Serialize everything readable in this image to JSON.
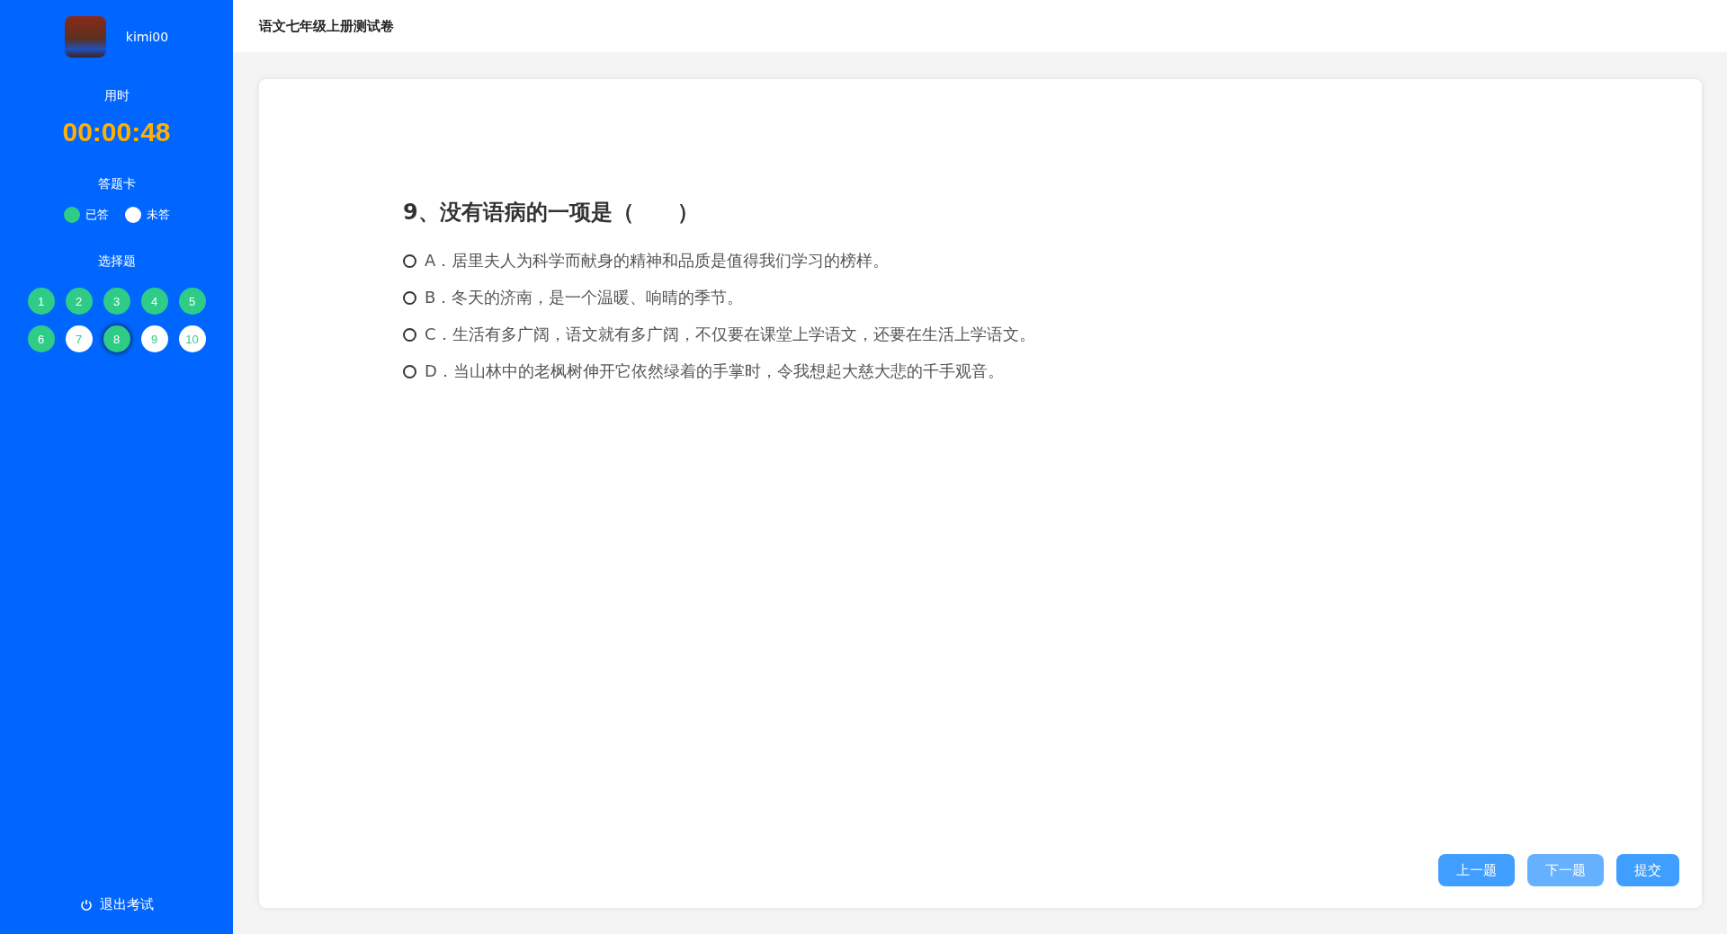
{
  "user": {
    "name": "kimi00"
  },
  "timer": {
    "label": "用时",
    "value": "00:00:48"
  },
  "answer_card": {
    "title": "答题卡",
    "legend": [
      {
        "label": "已答",
        "answered": true
      },
      {
        "label": "未答",
        "answered": false
      }
    ],
    "section": "选择题",
    "items": [
      {
        "label": "1",
        "answered": true,
        "selected": false
      },
      {
        "label": "2",
        "answered": true,
        "selected": false
      },
      {
        "label": "3",
        "answered": true,
        "selected": false
      },
      {
        "label": "4",
        "answered": true,
        "selected": false
      },
      {
        "label": "5",
        "answered": true,
        "selected": false
      },
      {
        "label": "6",
        "answered": true,
        "selected": false
      },
      {
        "label": "7",
        "answered": false,
        "selected": false
      },
      {
        "label": "8",
        "answered": true,
        "selected": true
      },
      {
        "label": "9",
        "answered": false,
        "selected": false
      },
      {
        "label": "10",
        "answered": false,
        "selected": false
      }
    ]
  },
  "exit": {
    "label": "退出考试"
  },
  "header": {
    "title": "语文七年级上册测试卷"
  },
  "question": {
    "title": "9、没有语病的一项是（　　）",
    "options": [
      {
        "text": "A．居里夫人为科学而献身的精神和品质是值得我们学习的榜样。",
        "checked": false
      },
      {
        "text": "B．冬天的济南，是一个温暖、响晴的季节。",
        "checked": false
      },
      {
        "text": "C．生活有多广阔，语文就有多广阔，不仅要在课堂上学语文，还要在生活上学语文。",
        "checked": false
      },
      {
        "text": "D．当山林中的老枫树伸开它依然绿着的手掌时，令我想起大慈大悲的千手观音。",
        "checked": false
      }
    ]
  },
  "buttons": [
    {
      "label": "上一题",
      "disabled": false
    },
    {
      "label": "下一题",
      "disabled": true
    },
    {
      "label": "提交",
      "disabled": false
    }
  ]
}
